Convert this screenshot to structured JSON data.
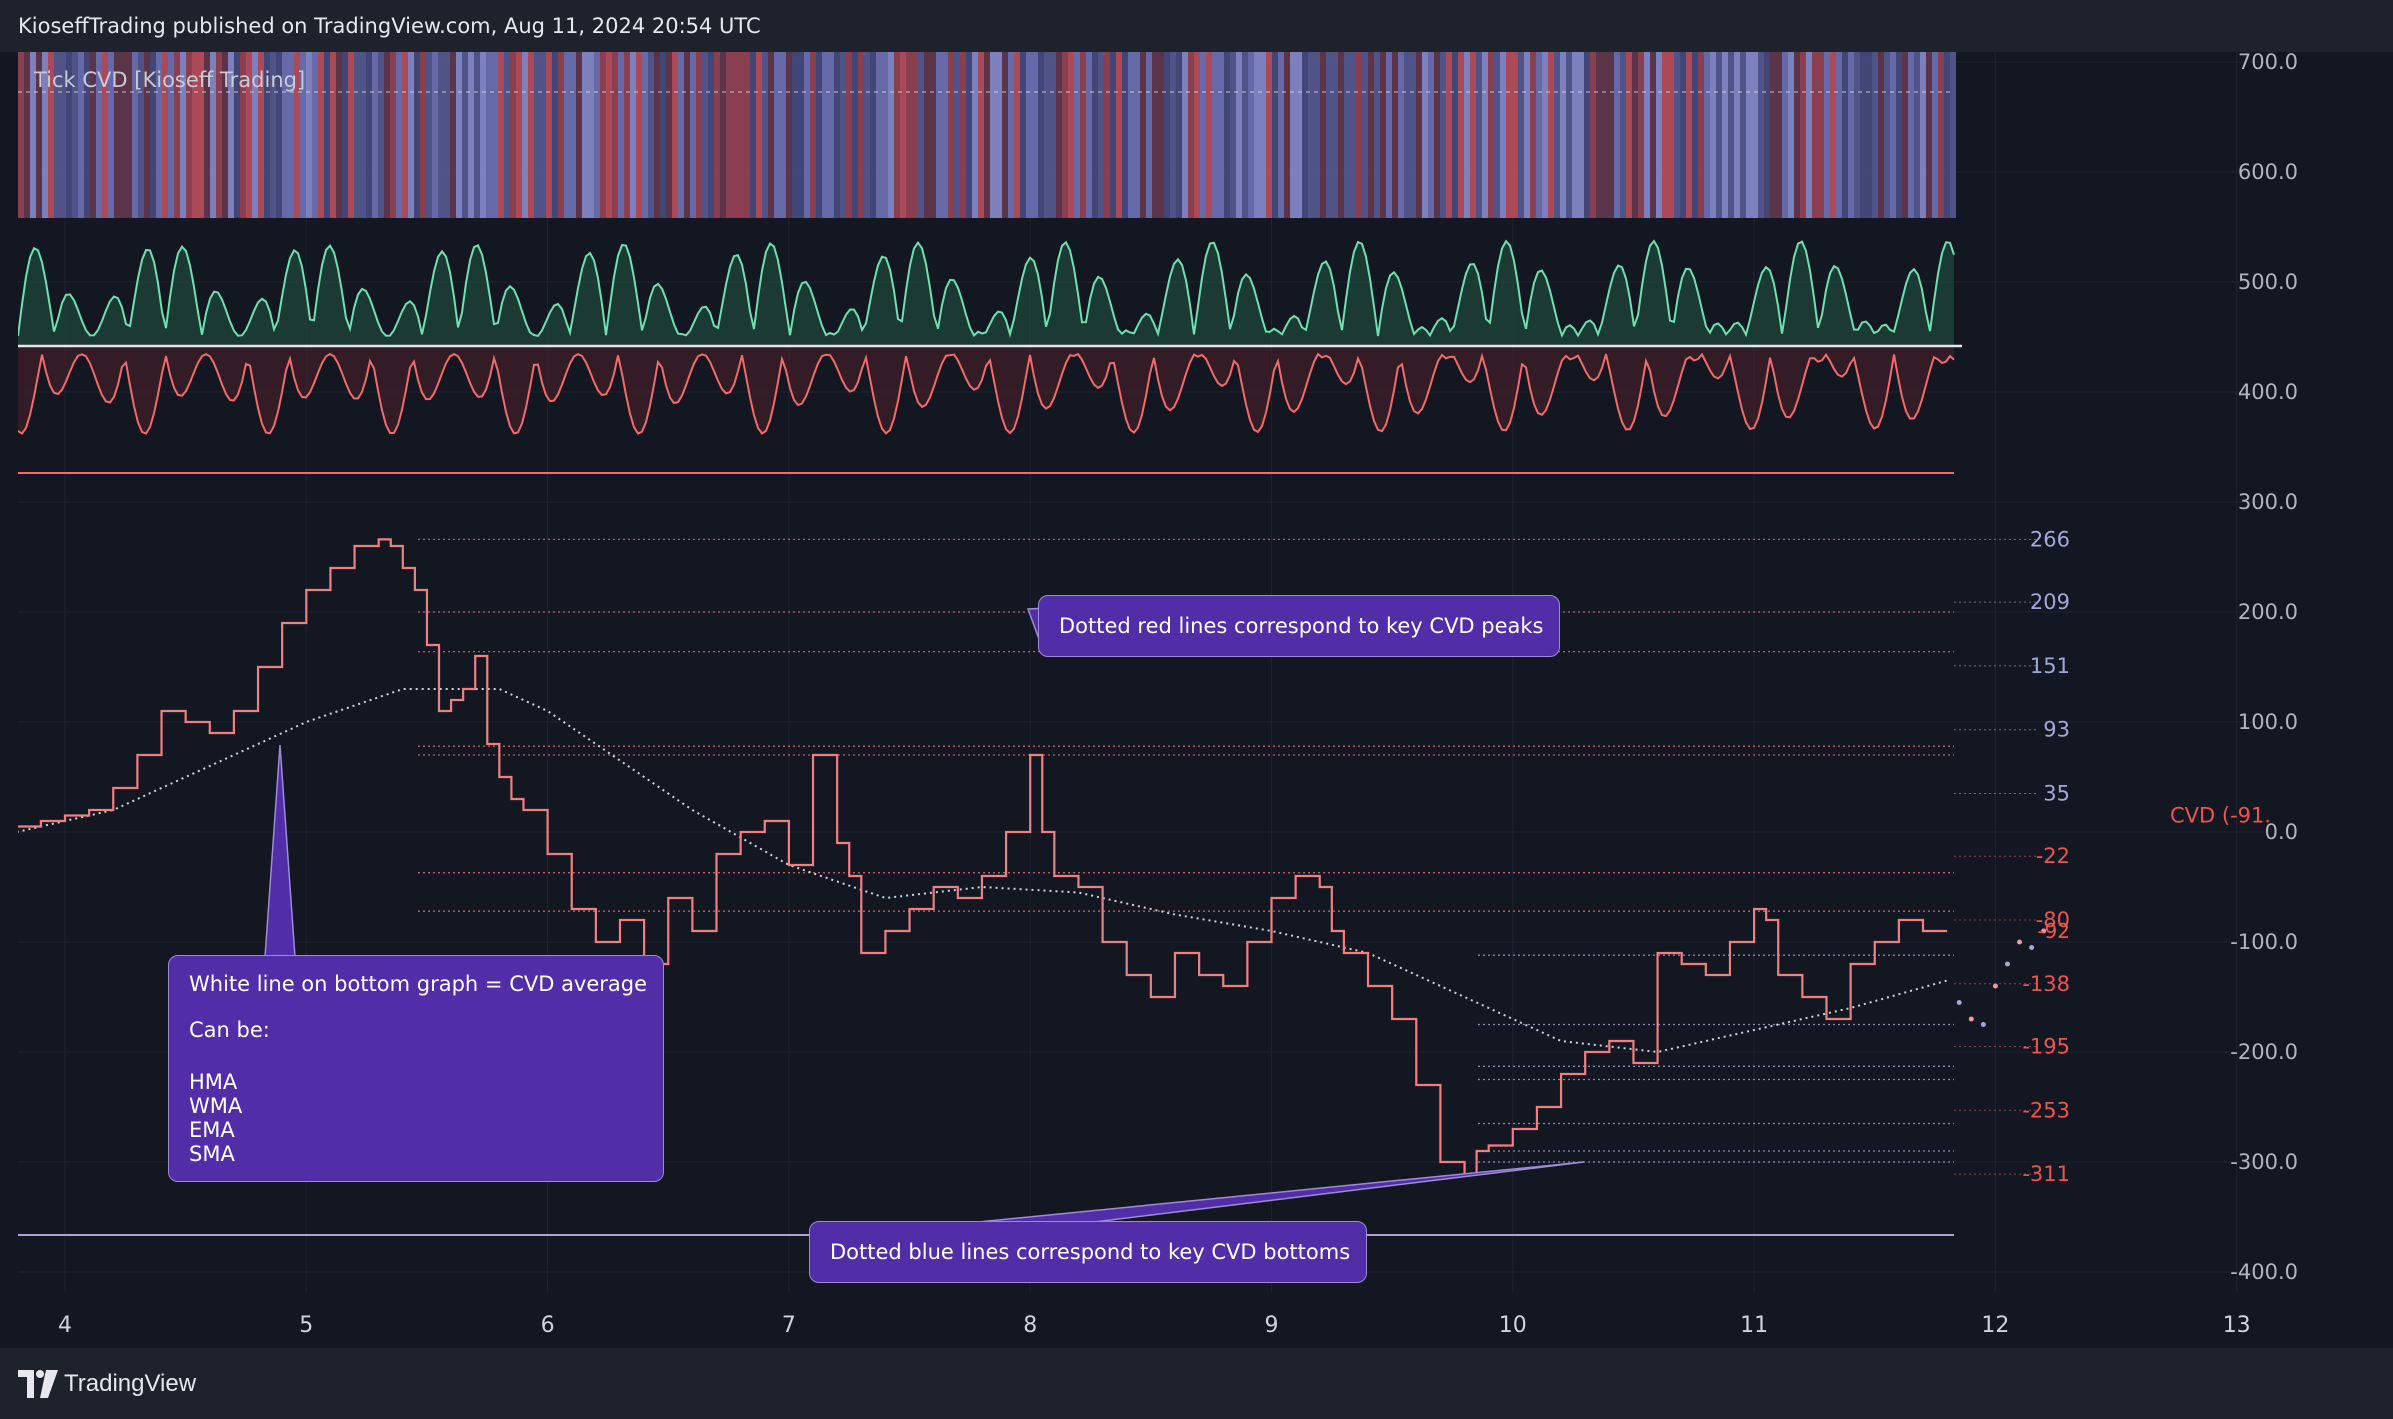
{
  "header": {
    "title": "KioseffTrading published on TradingView.com, Aug 11, 2024 20:54 UTC"
  },
  "footer": {
    "brand": "TradingView"
  },
  "indicator": {
    "name": "Tick CVD [Kioseff Trading]"
  },
  "colors": {
    "background": "#131722",
    "cvd_line": "#f08080",
    "peak_lines": "#e57373",
    "bottom_lines": "#9fa8da",
    "average_line": "#d1d4dc",
    "oscillator_up": "#6fe0b0",
    "oscillator_down": "#f26b6b",
    "callout": "#512da8"
  },
  "annotations": {
    "peaks": "Dotted red lines correspond to key CVD peaks",
    "bottoms": "Dotted blue lines correspond to key CVD bottoms",
    "average_title": "White line on bottom graph = CVD average",
    "average_can_be": "Can be:",
    "average_options": [
      "HMA",
      "WMA",
      "EMA",
      "SMA"
    ]
  },
  "chart_data": {
    "type": "line",
    "title": "",
    "xlabel": "",
    "ylabel": "",
    "x_ticks": [
      "4",
      "5",
      "6",
      "7",
      "8",
      "9",
      "10",
      "11",
      "12",
      "13"
    ],
    "y_ticks": [
      "700.0",
      "600.0",
      "500.0",
      "400.0",
      "300.0",
      "200.0",
      "100.0",
      "0.0",
      "-100.0",
      "-200.0",
      "-300.0",
      "-400.0"
    ],
    "ylim": [
      -400,
      700
    ],
    "current_label": "CVD (-91.",
    "current_value_label": "-92",
    "level_labels": [
      "266",
      "209",
      "151",
      "93",
      "35",
      "-22",
      "-80",
      "-138",
      "-195",
      "-253",
      "-311"
    ],
    "peak_levels": [
      266,
      200,
      164,
      78,
      70,
      -37,
      -72
    ],
    "bottom_levels": [
      -300,
      -290,
      -265,
      -225,
      -213,
      -175,
      -112
    ],
    "series": [
      {
        "x": [
          3.8,
          3.9,
          4.0,
          4.1,
          4.2,
          4.3,
          4.4,
          4.5,
          4.6,
          4.7,
          4.8,
          4.9,
          5.0,
          5.1,
          5.2,
          5.3,
          5.35,
          5.4,
          5.45,
          5.5,
          5.55,
          5.6,
          5.65,
          5.7,
          5.75,
          5.8,
          5.85,
          5.9,
          6.0,
          6.1,
          6.2,
          6.3,
          6.4,
          6.5,
          6.6,
          6.7,
          6.8,
          6.9,
          7.0,
          7.1,
          7.2,
          7.25,
          7.3,
          7.4,
          7.5,
          7.6,
          7.7,
          7.8,
          7.9,
          8.0,
          8.05,
          8.1,
          8.2,
          8.3,
          8.4,
          8.5,
          8.6,
          8.7,
          8.8,
          8.9,
          9.0,
          9.1,
          9.2,
          9.25,
          9.3,
          9.4,
          9.5,
          9.6,
          9.7,
          9.8,
          9.85,
          9.9,
          10.0,
          10.1,
          10.2,
          10.3,
          10.4,
          10.5,
          10.6,
          10.7,
          10.8,
          10.9,
          11.0,
          11.05,
          11.1,
          11.2,
          11.3,
          11.4,
          11.5,
          11.6,
          11.7,
          11.8
        ],
        "values": [
          0,
          5,
          10,
          15,
          20,
          40,
          70,
          110,
          100,
          90,
          110,
          150,
          190,
          220,
          240,
          260,
          266,
          260,
          240,
          220,
          170,
          110,
          120,
          130,
          160,
          80,
          50,
          30,
          20,
          -20,
          -70,
          -100,
          -80,
          -120,
          -60,
          -90,
          -20,
          0,
          10,
          -30,
          70,
          -10,
          -40,
          -110,
          -90,
          -70,
          -50,
          -60,
          -40,
          0,
          70,
          0,
          -40,
          -50,
          -100,
          -130,
          -150,
          -110,
          -130,
          -140,
          -100,
          -60,
          -40,
          -50,
          -90,
          -110,
          -140,
          -170,
          -230,
          -300,
          -311,
          -290,
          -285,
          -270,
          -250,
          -220,
          -200,
          -190,
          -210,
          -110,
          -120,
          -130,
          -100,
          -70,
          -80,
          -130,
          -150,
          -170,
          -120,
          -100,
          -80,
          -90
        ],
        "name": ""
      }
    ],
    "average": {
      "x": [
        3.8,
        4.2,
        4.6,
        5.0,
        5.4,
        5.6,
        5.8,
        6.0,
        6.2,
        6.6,
        7.0,
        7.4,
        7.8,
        8.2,
        8.6,
        9.0,
        9.4,
        9.8,
        10.2,
        10.6,
        11.0,
        11.4,
        11.8
      ],
      "values": [
        0,
        20,
        60,
        100,
        130,
        130,
        130,
        110,
        80,
        20,
        -30,
        -60,
        -50,
        -55,
        -75,
        -90,
        -110,
        -150,
        -190,
        -200,
        -180,
        -160,
        -135
      ]
    }
  }
}
